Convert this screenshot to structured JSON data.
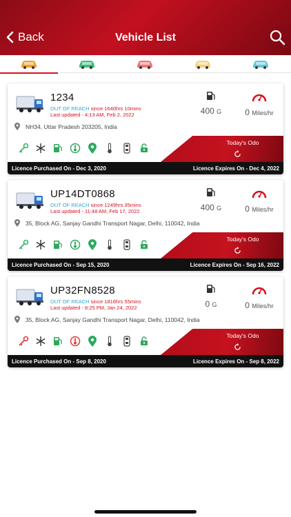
{
  "header": {
    "title": "Vehicle List",
    "back_label": "Back"
  },
  "tabs": [
    {
      "name": "tab-all",
      "color": "#f0a12a"
    },
    {
      "name": "tab-green",
      "color": "#3bbf7a"
    },
    {
      "name": "tab-red",
      "color": "#f07474"
    },
    {
      "name": "tab-yellow",
      "color": "#f3d27a"
    },
    {
      "name": "tab-blue",
      "color": "#62c7dd"
    }
  ],
  "vehicles": [
    {
      "number": "1234",
      "status": "OUT OF REACH",
      "since": "since 1640hrs 10mins",
      "updated": "Last updated - 4:13 AM, Feb 2, 2022",
      "fuel": "400",
      "fuel_unit": "G",
      "speed": "0",
      "speed_unit": "Miles/hr",
      "address": "NH34, Uttar Pradesh 203205, India",
      "odo_label": "Today's Odo",
      "licence_purchased": "Licence Purchased On - Dec 3, 2020",
      "licence_expires": "Licence Expires On - Dec 4, 2022",
      "key_color": "#3bb56a",
      "ignition_color": "#2fa85e"
    },
    {
      "number": "UP14DT0868",
      "status": "OUT OF REACH",
      "since": "since 1249hrs 35mins",
      "updated": "Last updated - 11:48 AM, Feb 17, 2022",
      "fuel": "400",
      "fuel_unit": "G",
      "speed": "0",
      "speed_unit": "Miles/hr",
      "address": "35, Block AG, Sanjay Gandhi Transport Nagar, Delhi, 110042, India",
      "odo_label": "Today's Odo",
      "licence_purchased": "Licence Purchased On - Sep 15, 2020",
      "licence_expires": "Licence Expires On - Sep 16, 2022",
      "key_color": "#3bb56a",
      "ignition_color": "#2fa85e"
    },
    {
      "number": "UP32FN8528",
      "status": "OUT OF REACH",
      "since": "since 1816hrs 55mins",
      "updated": "Last updated - 8:25 PM, Jan 24, 2022",
      "fuel": "0",
      "fuel_unit": "G",
      "speed": "0",
      "speed_unit": "Miles/hr",
      "address": "35, Block AG, Sanjay Gandhi Transport Nagar, Delhi, 110042, India",
      "odo_label": "Today's Odo",
      "licence_purchased": "Licence Purchased On - Sep 8, 2020",
      "licence_expires": "Licence Expires On - Sep 8, 2022",
      "key_color": "#e23a3a",
      "ignition_color": "#e23a3a"
    }
  ],
  "icons": [
    "key-icon",
    "ac-icon",
    "fuel-pump-icon",
    "ignition-icon",
    "gps-icon",
    "temperature-icon",
    "door-icon",
    "lock-icon"
  ],
  "colors": {
    "brand": "#c3101f",
    "status_cyan": "#2aa7d6",
    "status_red": "#d6101f",
    "icon_green": "#2fa85e"
  }
}
